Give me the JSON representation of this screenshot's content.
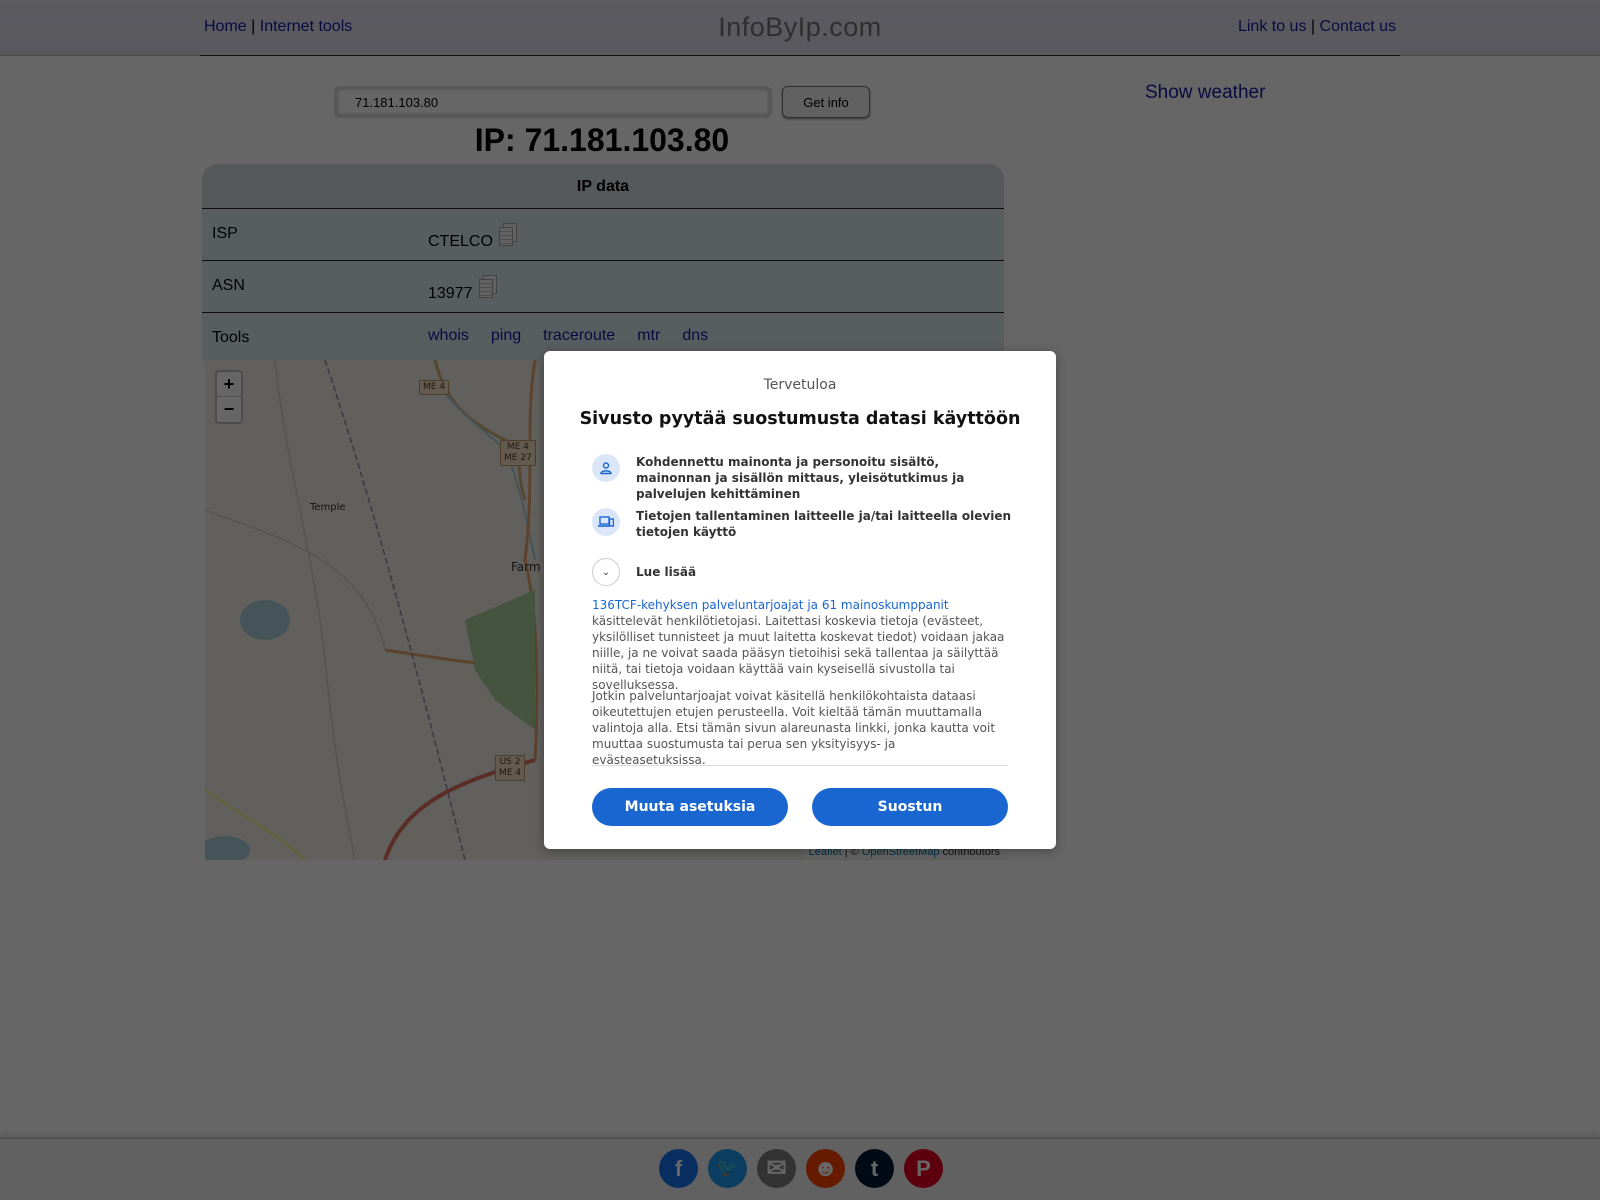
{
  "header": {
    "nav_left": [
      {
        "label": "Home"
      },
      {
        "label": "Internet tools"
      }
    ],
    "separator": "|",
    "site_title": "InfoByIp.com",
    "nav_right": [
      {
        "label": "Link to us"
      },
      {
        "label": "Contact us"
      }
    ]
  },
  "search": {
    "value": "71.181.103.80",
    "button_label": "Get info"
  },
  "ip_heading": "IP: 71.181.103.80",
  "show_weather": "Show weather",
  "ip_data": {
    "title": "IP data",
    "rows": [
      {
        "label": "ISP",
        "value": "CTELCO",
        "icon": "copy-icon"
      },
      {
        "label": "ASN",
        "value": "13977",
        "icon": "copy-icon"
      }
    ],
    "tools_label": "Tools",
    "tools": [
      "whois",
      "ping",
      "traceroute",
      "mtr",
      "dns"
    ]
  },
  "map": {
    "zoom_in": "+",
    "zoom_out": "−",
    "places": [
      "Temple",
      "Farm"
    ],
    "shields": [
      "ME 4",
      "ME 4\nME 27",
      "US 2\nME 4"
    ],
    "attribution": {
      "leaflet": "Leaflet",
      "sep": " | © ",
      "osm": "OpenStreetMap",
      "suffix": " contributors"
    }
  },
  "consent": {
    "welcome": "Tervetuloa",
    "title": "Sivusto pyytää suostumusta datasi käyttöön",
    "purposes": [
      {
        "icon": "person-icon",
        "text": "Kohdennettu mainonta ja personoitu sisältö, mainonnan ja sisällön mittaus, yleisötutkimus ja palvelujen kehittäminen"
      },
      {
        "icon": "devices-icon",
        "text": "Tietojen tallentaminen laitteelle ja/tai laitteella olevien tietojen käyttö"
      }
    ],
    "read_more": "Lue lisää",
    "partners_link": "136TCF-kehyksen palveluntarjoajat ja 61 mainoskumppanit",
    "paragraph1_rest": " käsittelevät henkilötietojasi. Laitettasi koskevia tietoja (evästeet, yksilölliset tunnisteet ja muut laitetta koskevat tiedot) voidaan jakaa niille, ja ne voivat saada pääsyn tietoihisi sekä tallentaa ja säilyttää niitä, tai tietoja voidaan käyttää vain kyseisellä sivustolla tai sovelluksessa.",
    "paragraph2": "Jotkin palveluntarjoajat voivat käsitellä henkilökohtaista dataasi oikeutettujen etujen perusteella. Voit kieltää tämän muuttamalla valintoja alla. Etsi tämän sivun alareunasta linkki, jonka kautta voit muuttaa suostumusta tai perua sen yksityisyys- ja evästeasetuksissa.",
    "buttons": {
      "settings": "Muuta asetuksia",
      "accept": "Suostun"
    },
    "accent": "#1a66d1"
  },
  "footer": {
    "share": [
      {
        "name": "facebook",
        "glyph": "f",
        "color": "#1877f2"
      },
      {
        "name": "twitter",
        "glyph": "🐦",
        "color": "#1d9bf0"
      },
      {
        "name": "email",
        "glyph": "✉",
        "color": "#7f7f7f"
      },
      {
        "name": "reddit",
        "glyph": "☻",
        "color": "#ff4500"
      },
      {
        "name": "tumblr",
        "glyph": "t",
        "color": "#001935"
      },
      {
        "name": "pinterest",
        "glyph": "P",
        "color": "#e60023"
      }
    ]
  }
}
